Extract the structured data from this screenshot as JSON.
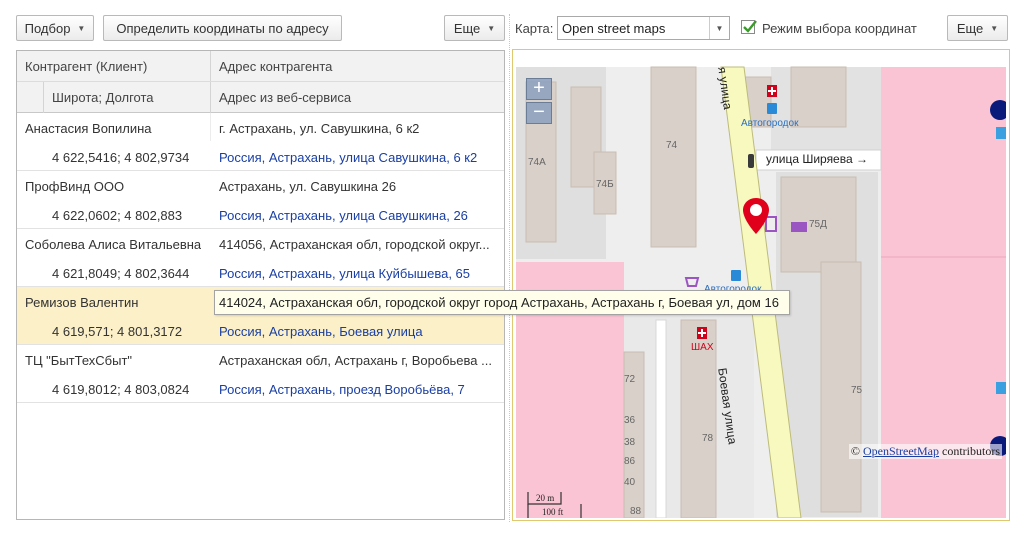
{
  "toolbar": {
    "pick_label": "Подбор",
    "geocode_label": "Определить координаты по адресу",
    "more_left_label": "Еще",
    "map_label": "Карта:",
    "map_provider": "Open street maps",
    "coord_mode_label": "Режим выбора координат",
    "coord_mode_checked": true,
    "more_right_label": "Еще"
  },
  "table": {
    "headers": {
      "client": "Контрагент (Клиент)",
      "address": "Адрес контрагента",
      "latlon": "Широта; Долгота",
      "web_address": "Адрес из веб-сервиса"
    },
    "rows": [
      {
        "name": "Анастасия Вопилина",
        "address": "г. Астрахань, ул. Савушкина, 6 к2",
        "coords": "4 622,5416; 4 802,9734",
        "web": "Россия, Астрахань, улица Савушкина, 6 к2"
      },
      {
        "name": "ПрофВинд ООО",
        "address": "Астрахань, ул. Савушкина 26",
        "coords": "4 622,0602; 4 802,883",
        "web": "Россия, Астрахань, улица Савушкина, 26"
      },
      {
        "name": "Соболева Алиса Витальевна",
        "address": "414056, Астраханская обл, городской округ...",
        "coords": "4 621,8049; 4 802,3644",
        "web": "Россия, Астрахань, улица Куйбышева, 65"
      },
      {
        "name": "Ремизов Валентин",
        "address": "414024, Астраханская обл, городской округ город Астрахань, Астрахань г, Боевая ул, дом 16",
        "coords": "4 619,571; 4 801,3172",
        "web": "Россия, Астрахань, Боевая улица"
      },
      {
        "name": "ТЦ \"БытТехСбыт\"",
        "address": "Астраханская обл, Астрахань г, Воробьева ...",
        "coords": "4 619,8012; 4 803,0824",
        "web": "Россия, Астрахань, проезд Воробьёва, 7"
      }
    ],
    "selected_row": 3,
    "tooltip": "414024, Астраханская обл, городской округ город Астрахань, Астрахань г, Боевая ул, дом 16"
  },
  "map": {
    "zoom_in": "+",
    "zoom_out": "−",
    "streets": {
      "shiryaeva": "улица Ширяева",
      "boevaya": "Боевая улица",
      "top": "я улица"
    },
    "places": {
      "avtogorodok": "Автогородок",
      "avtogorodok2": "Автогородок",
      "shah": "ШАХ"
    },
    "buildings": [
      "74А",
      "74",
      "74Б",
      "75Д",
      "75",
      "78",
      "86",
      "88",
      "72",
      "36",
      "38",
      "40"
    ],
    "scale": {
      "metric": "20 m",
      "imperial": "100 ft"
    },
    "attribution_prefix": "© ",
    "attribution_link": "OpenStreetMap",
    "attribution_suffix": " contributors",
    "colors": {
      "road": "#f7f9bf",
      "residential": "#fbc4d4",
      "building": "#d9d0c9",
      "marker": "#e0001b"
    }
  }
}
